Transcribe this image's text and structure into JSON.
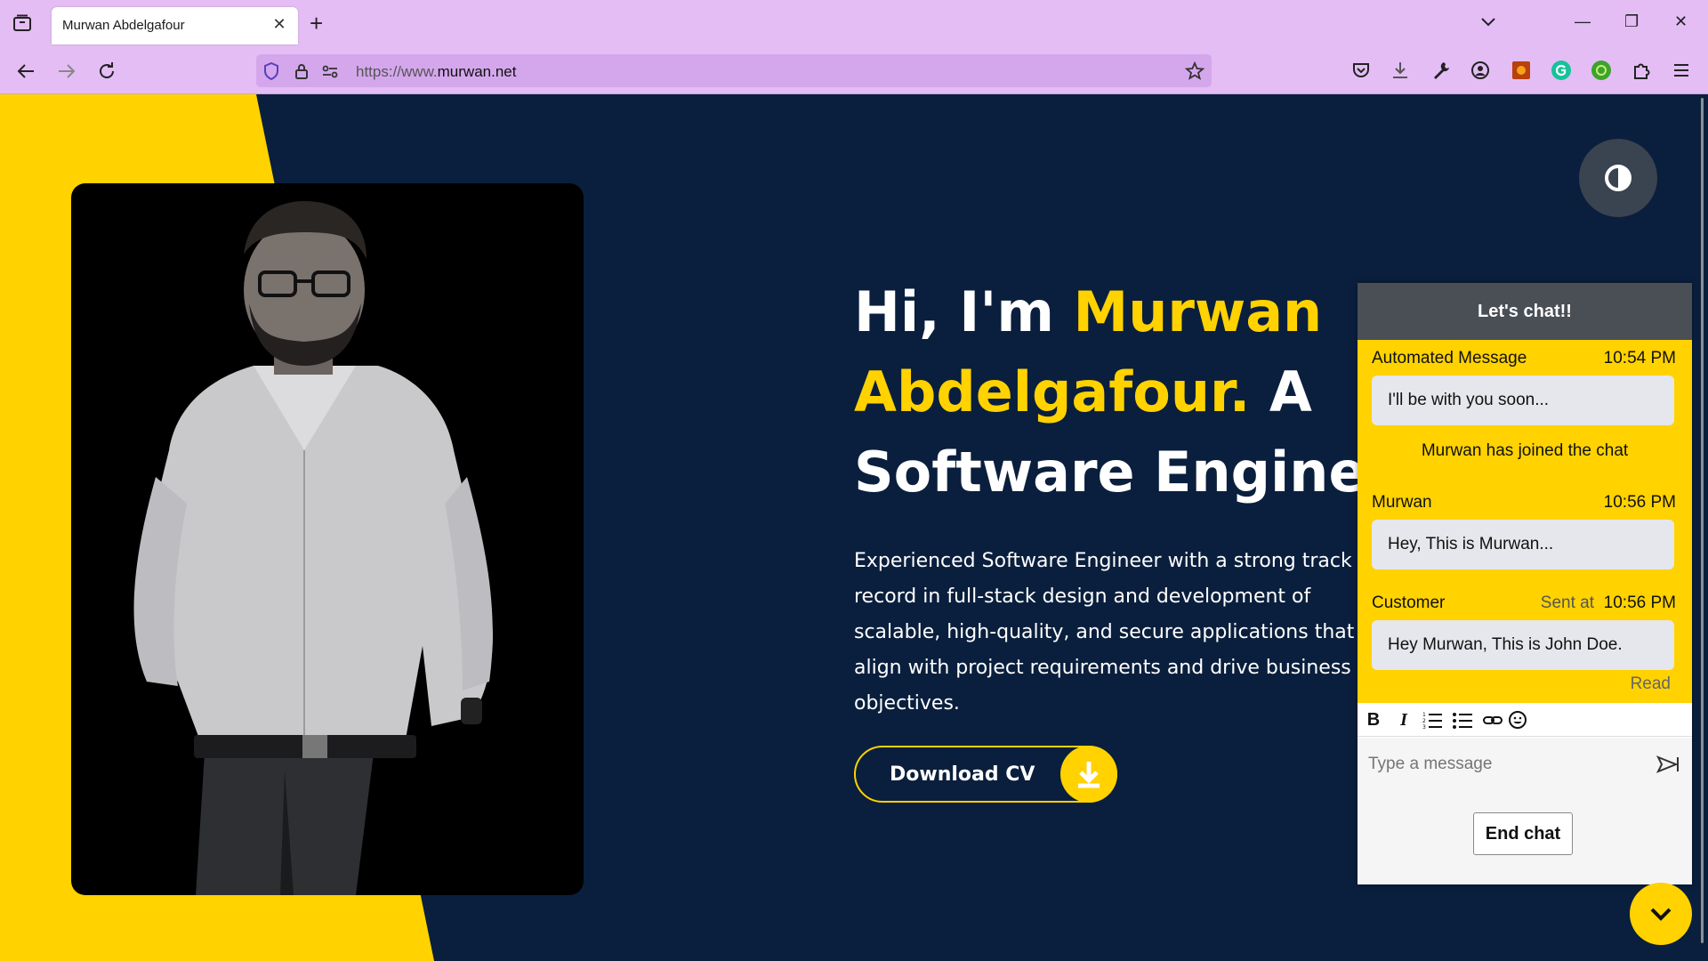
{
  "browser": {
    "tab_title": "Murwan Abdelgafour",
    "tab_close": "✕",
    "new_tab": "+",
    "url_prefix": "https://www.",
    "url_domain": "murwan.net",
    "window_controls": {
      "minimize": "—",
      "restore": "❐",
      "close": "✕"
    }
  },
  "hero": {
    "greeting": "Hi, I'm ",
    "name_line1": "Murwan",
    "name_line2": "Abdelgafour.",
    "role_a": " A",
    "role_line": "Software Engineer.",
    "description": "Experienced Software Engineer with a strong track record in full-stack design and development of scalable, high-quality, and secure applications that align with project requirements and drive business objectives.",
    "cv_button": "Download CV"
  },
  "chat": {
    "title": "Let's chat!!",
    "messages": [
      {
        "sender": "Automated Message",
        "time": "10:54 PM",
        "text": "I'll be with you soon..."
      },
      {
        "sender": "Murwan",
        "time": "10:56 PM",
        "text": "Hey, This is Murwan..."
      },
      {
        "sender": "Customer",
        "sent_label": "Sent at",
        "time": "10:56 PM",
        "text": "Hey Murwan, This is John Doe.",
        "status": "Read"
      }
    ],
    "system_notice": "Murwan has joined the chat",
    "toolbar": {
      "bold": "B",
      "italic": "I"
    },
    "input_placeholder": "Type a message",
    "end_button": "End chat"
  },
  "colors": {
    "accent": "#ffd200",
    "page_bg": "#0a1f3d",
    "browser_chrome": "#e4bdf5"
  }
}
